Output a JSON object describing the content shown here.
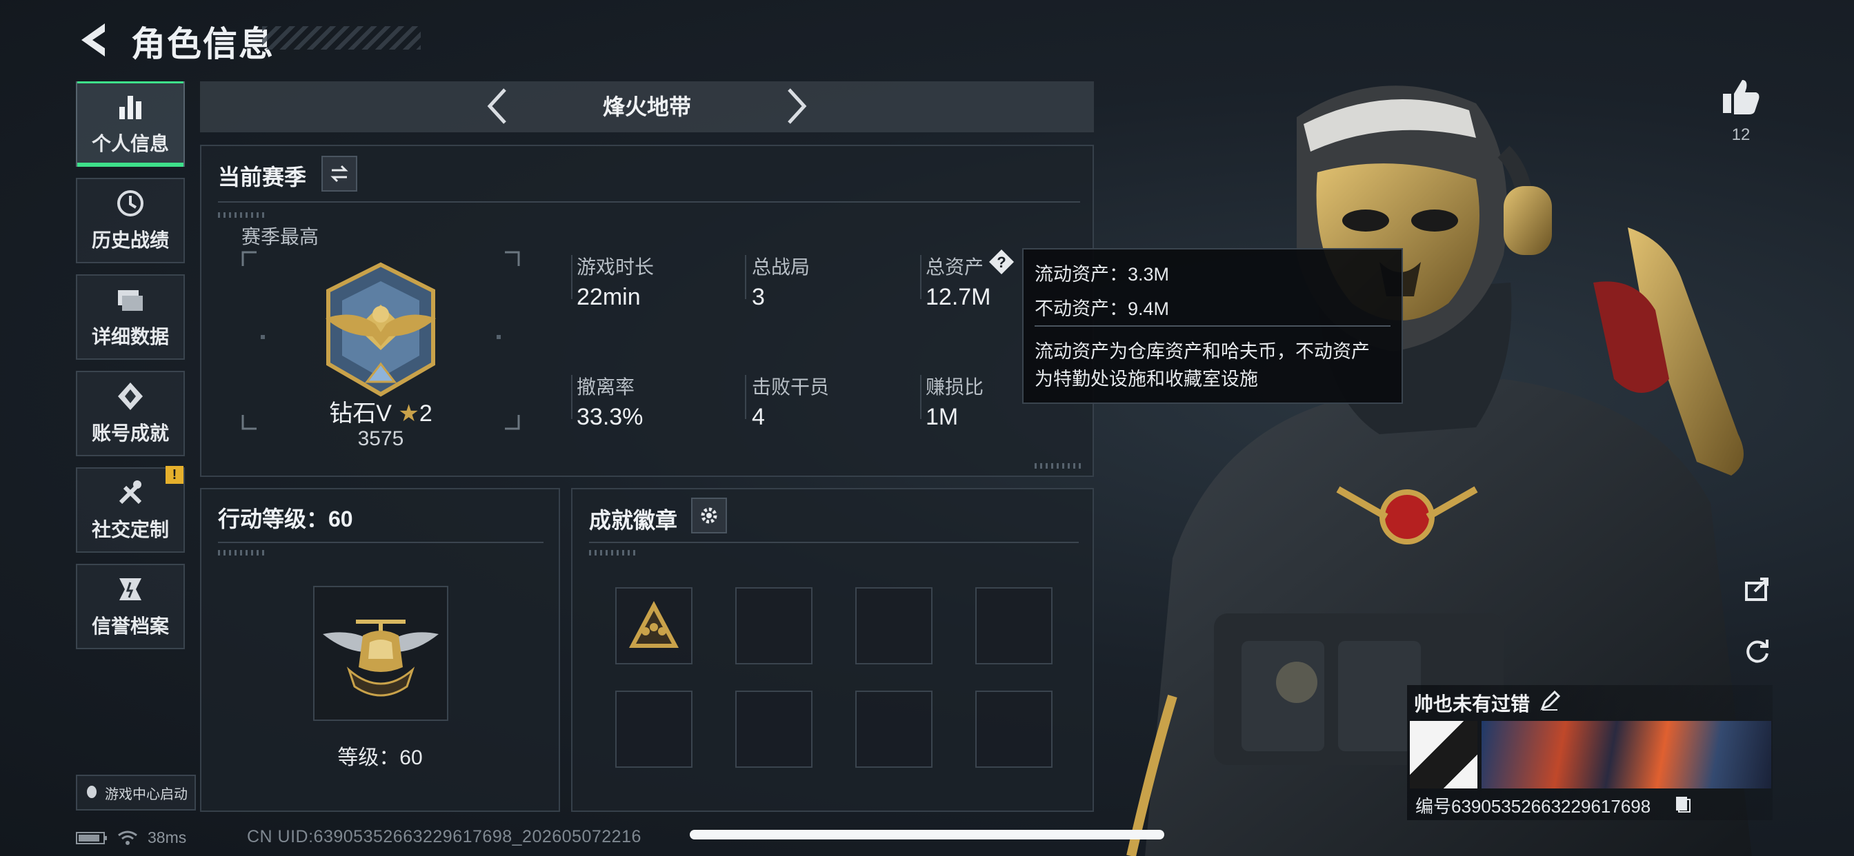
{
  "header": {
    "title": "角色信息"
  },
  "sidebar": {
    "items": [
      {
        "label": "个人信息",
        "icon": "bar-chart-icon",
        "active": true
      },
      {
        "label": "历史战绩",
        "icon": "history-icon"
      },
      {
        "label": "详细数据",
        "icon": "folder-icon"
      },
      {
        "label": "账号成就",
        "icon": "achievement-icon"
      },
      {
        "label": "社交定制",
        "icon": "tools-icon",
        "badge": "!"
      },
      {
        "label": "信誉档案",
        "icon": "credit-icon"
      }
    ],
    "game_center_label": "游戏中心启动"
  },
  "mode": {
    "title": "烽火地带"
  },
  "season": {
    "title": "当前赛季",
    "best_label": "赛季最高",
    "rank_name": "钻石V",
    "rank_stars": "2",
    "rank_score": "3575",
    "stats": [
      {
        "label": "游戏时长",
        "value": "22min"
      },
      {
        "label": "总战局",
        "value": "3"
      },
      {
        "label": "总资产",
        "value": "12.7M"
      },
      {
        "label": "撤离率",
        "value": "33.3%"
      },
      {
        "label": "击败干员",
        "value": "4"
      },
      {
        "label": "赚损比",
        "value": "1M"
      }
    ]
  },
  "tooltip": {
    "liquid": "流动资产：3.3M",
    "fixed": "不动资产：9.4M",
    "desc_line1": "流动资产为仓库资产和哈夫币，不动资产",
    "desc_line2": "为特勤处设施和收藏室设施"
  },
  "action_level": {
    "title": "行动等级：60",
    "level_text": "等级：60"
  },
  "badges": {
    "title": "成就徽章"
  },
  "profile": {
    "likes": "12",
    "name": "帅也未有过错",
    "id_text": "编号6390535266322961769​8"
  },
  "status": {
    "ping": "38ms",
    "uid": "CN UID:6390535266322961769​8_202605072216"
  },
  "colors": {
    "accent": "#3ee08a",
    "warn": "#e6b02c",
    "gold": "#c9a24a"
  }
}
